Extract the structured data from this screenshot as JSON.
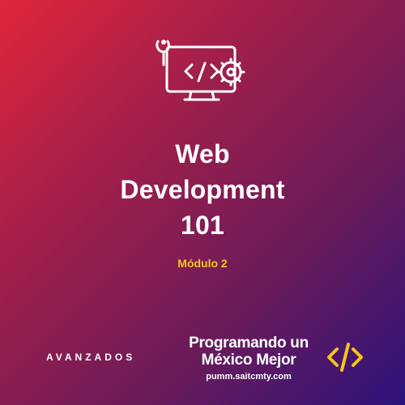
{
  "course": {
    "title_lines": [
      "Web",
      "Development",
      "101"
    ],
    "module": "Módulo 2",
    "level": "AVANZADOS"
  },
  "brand": {
    "name_line1": "Programando un",
    "name_line2": "México Mejor",
    "url": "pumm.saitcmty.com"
  },
  "icons": {
    "hero": "monitor-code-wrench-gear-icon",
    "brand": "code-brackets-icon"
  },
  "colors": {
    "gradient_start": "#e1263c",
    "gradient_mid": "#6a1b5a",
    "gradient_end": "#2c137c",
    "accent": "#f5c518",
    "text": "#ffffff"
  }
}
